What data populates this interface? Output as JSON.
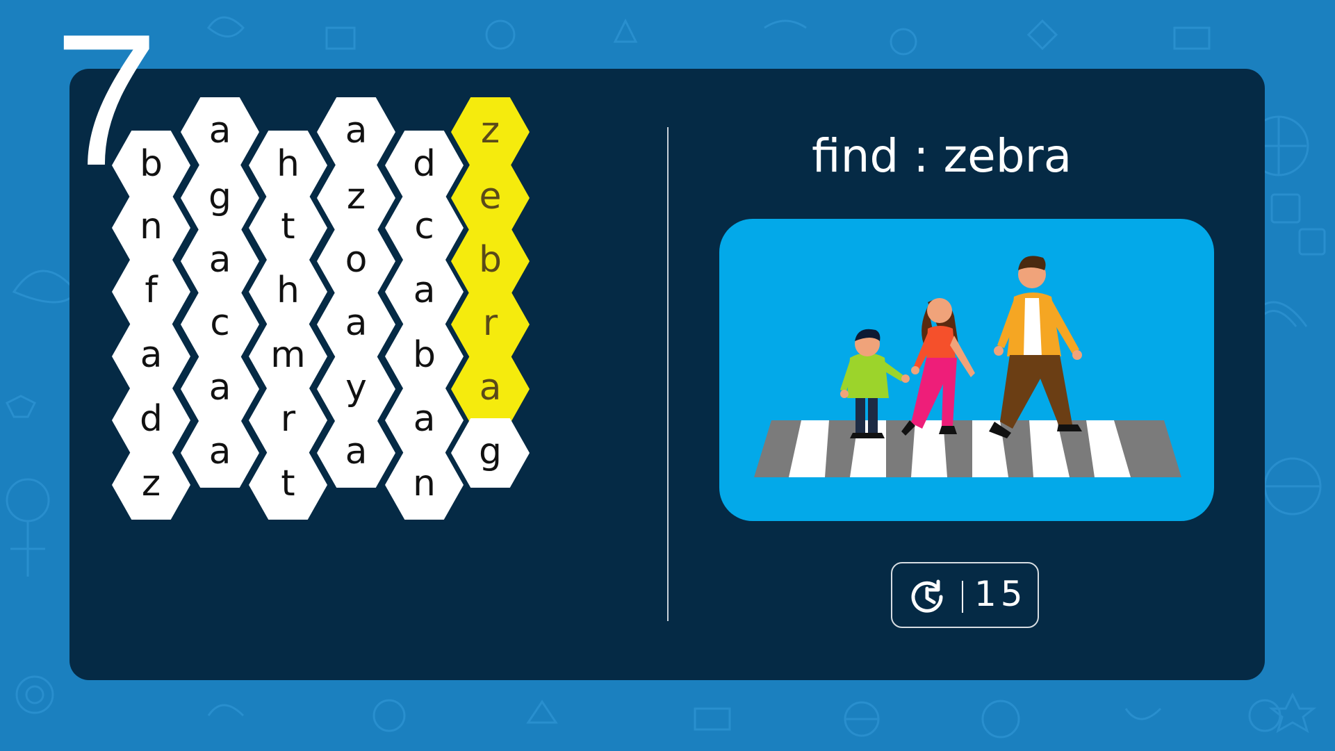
{
  "level": "7",
  "prompt": "find : zebra",
  "timer": {
    "icon": "clock-refresh-icon",
    "value": "15"
  },
  "colors": {
    "background": "#1b80bf",
    "panel": "#052a45",
    "tile": "#ffffff",
    "tile_selected": "#f5eb0d",
    "scene": "#03a9e9"
  },
  "scene": {
    "icon": "family-crossing-zebra-crosswalk-illustration"
  },
  "grid": {
    "columns": [
      {
        "tiles": [
          {
            "l": "b"
          },
          {
            "l": "n"
          },
          {
            "l": "f"
          },
          {
            "l": "a"
          },
          {
            "l": "d"
          },
          {
            "l": "z"
          }
        ]
      },
      {
        "tiles": [
          {
            "l": "a"
          },
          {
            "l": "g"
          },
          {
            "l": "a"
          },
          {
            "l": "c"
          },
          {
            "l": "a"
          },
          {
            "l": "a"
          }
        ]
      },
      {
        "tiles": [
          {
            "l": "h"
          },
          {
            "l": "t"
          },
          {
            "l": "h"
          },
          {
            "l": "m"
          },
          {
            "l": "r"
          },
          {
            "l": "t"
          }
        ]
      },
      {
        "tiles": [
          {
            "l": "a"
          },
          {
            "l": "z"
          },
          {
            "l": "o"
          },
          {
            "l": "a"
          },
          {
            "l": "y"
          },
          {
            "l": "a"
          }
        ]
      },
      {
        "tiles": [
          {
            "l": "d"
          },
          {
            "l": "c"
          },
          {
            "l": "a"
          },
          {
            "l": "b"
          },
          {
            "l": "a"
          },
          {
            "l": "n"
          }
        ]
      },
      {
        "tiles": [
          {
            "l": "z",
            "selected": true
          },
          {
            "l": "e",
            "selected": true
          },
          {
            "l": "b",
            "selected": true
          },
          {
            "l": "r",
            "selected": true
          },
          {
            "l": "a",
            "selected": true
          },
          {
            "l": "g"
          }
        ]
      }
    ]
  }
}
